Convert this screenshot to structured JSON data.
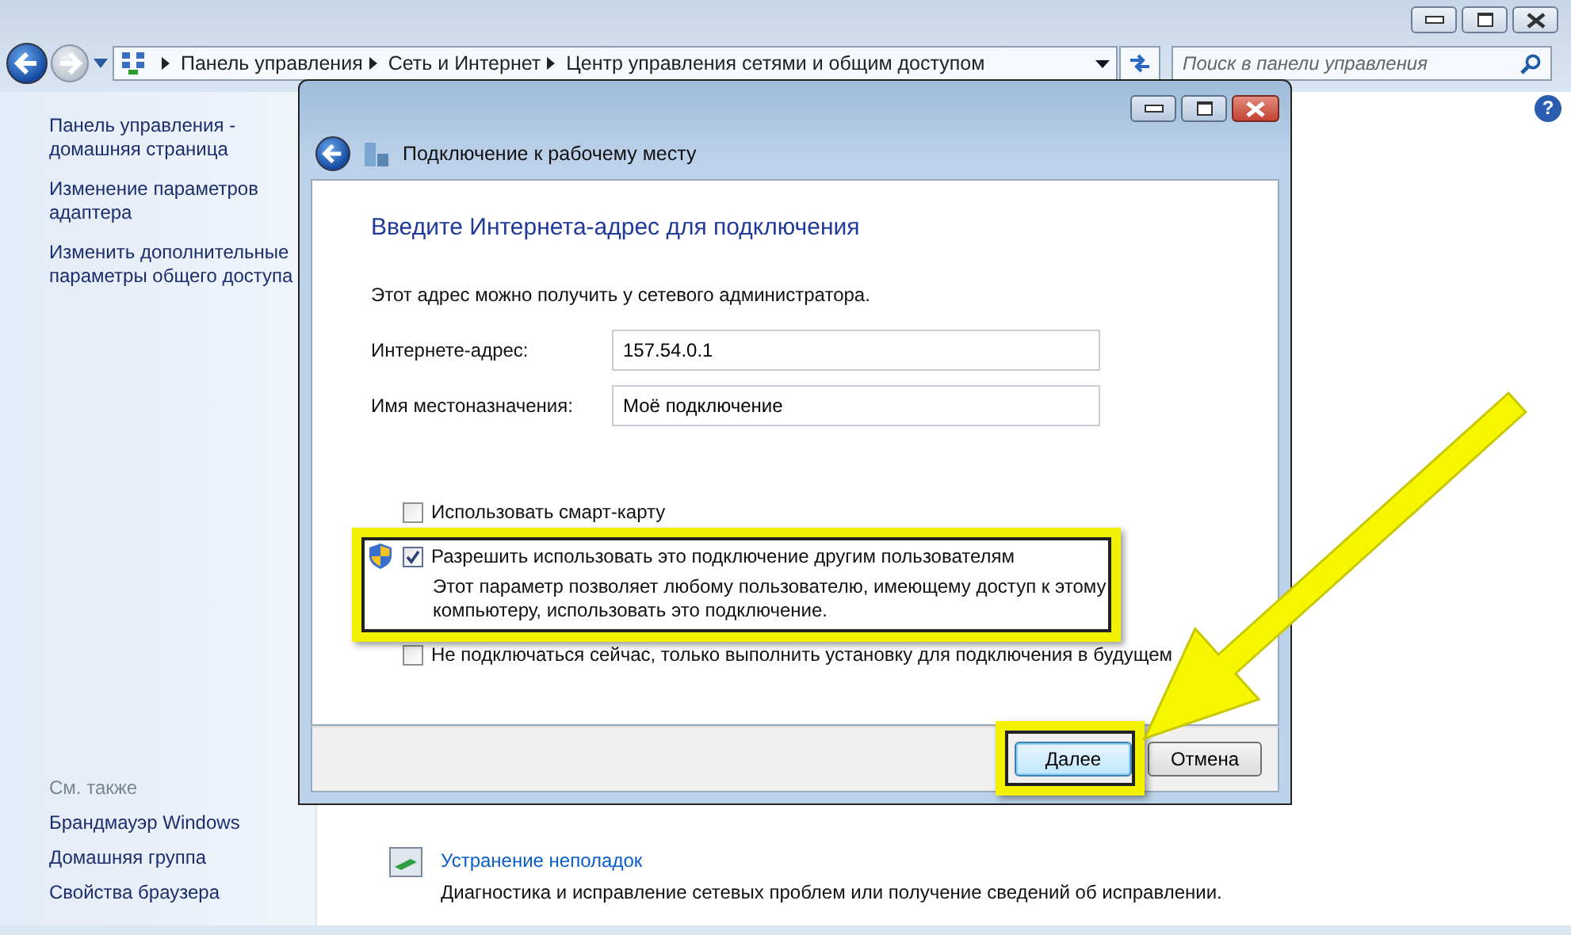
{
  "explorer": {
    "address": {
      "crumbs": [
        "Панель управления",
        "Сеть и Интернет",
        "Центр управления сетями и общим доступом"
      ]
    },
    "search": {
      "placeholder": "Поиск в панели управления"
    },
    "help_button": "?",
    "sidebar": {
      "links": [
        "Панель управления - домашняя страница",
        "Изменение параметров адаптера",
        "Изменить дополнительные параметры общего доступа"
      ],
      "see_also_title": "См. также",
      "see_also": [
        "Брандмауэр Windows",
        "Домашняя группа",
        "Свойства браузера"
      ]
    },
    "troubleshoot": {
      "title": "Устранение неполадок",
      "description": "Диагностика и исправление сетевых проблем или получение сведений об исправлении."
    }
  },
  "dialog": {
    "title": "Подключение к рабочему месту",
    "heading": "Введите Интернета-адрес для подключения",
    "hint": "Этот адрес можно получить у сетевого администратора.",
    "fields": [
      {
        "label": "Интернете-адрес:",
        "value": "157.54.0.1"
      },
      {
        "label": "Имя местоназначения:",
        "value": "Моё подключение"
      }
    ],
    "options": [
      {
        "kind": "checkbox",
        "label": "Использовать смарт-карту",
        "checked": false
      },
      {
        "kind": "admin-checkbox",
        "label": "Разрешить использовать это подключение другим пользователям",
        "checked": true,
        "description": "Этот параметр позволяет любому пользователю, имеющему доступ к этому компьютеру, использовать это подключение."
      },
      {
        "kind": "checkbox",
        "label": "Не подключаться сейчас, только выполнить установку для подключения в будущем",
        "checked": false
      }
    ],
    "buttons": [
      {
        "label": "Далее",
        "default": true
      },
      {
        "label": "Отмена",
        "default": false
      }
    ]
  }
}
